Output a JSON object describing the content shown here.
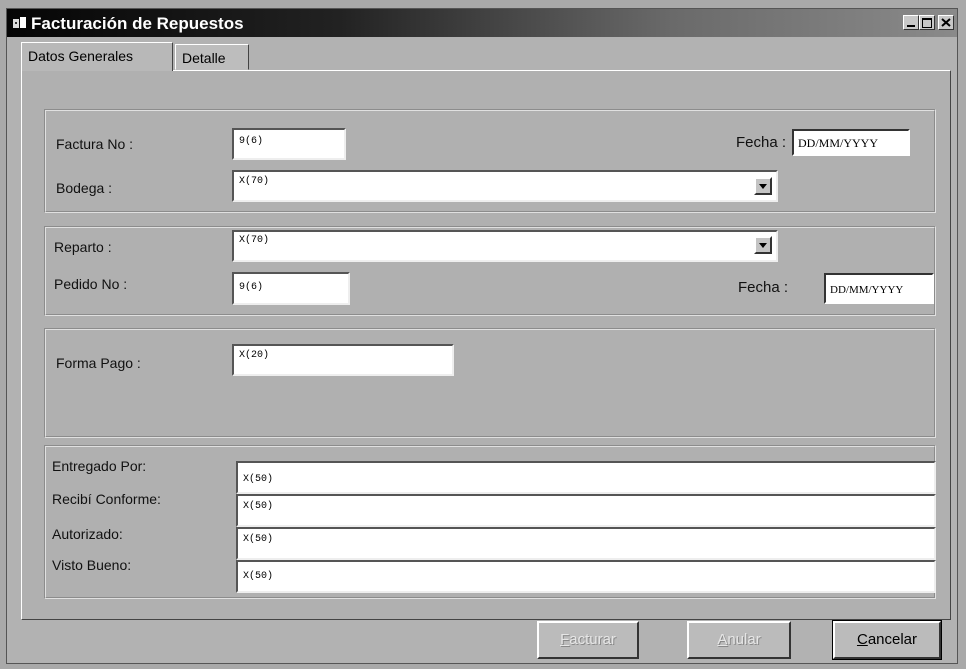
{
  "window": {
    "title": "Facturación de Repuestos"
  },
  "tabs": [
    {
      "label": "Datos Generales",
      "active": true
    },
    {
      "label": "Detalle",
      "active": false
    }
  ],
  "group1": {
    "factura_label": "Factura No :",
    "factura_value": "9(6)",
    "fecha_label": "Fecha :",
    "fecha_value": "DD/MM/YYYY",
    "bodega_label": "Bodega :",
    "bodega_value": "X(70)"
  },
  "group2": {
    "reparto_label": "Reparto :",
    "reparto_value": "X(70)",
    "pedido_label": "Pedido No :",
    "pedido_value": "9(6)",
    "fecha_label": "Fecha :",
    "fecha_value": "DD/MM/YYYY"
  },
  "group3": {
    "forma_pago_label": "Forma Pago :",
    "forma_pago_value": "X(20)"
  },
  "group4": {
    "entregado_label": "Entregado Por:",
    "entregado_value": "X(50)",
    "recibi_label": "Recibí Conforme:",
    "recibi_value": "X(50)",
    "autorizado_label": "Autorizado:",
    "autorizado_value": "X(50)",
    "visto_label": "Visto Bueno:",
    "visto_value": "X(50)"
  },
  "buttons": {
    "facturar_first": "F",
    "facturar_rest": "acturar",
    "anular_first": "A",
    "anular_rest": "nular",
    "cancelar_first": "C",
    "cancelar_rest": "ancelar"
  },
  "icons": [
    "app-icon",
    "minimize-icon",
    "maximize-icon",
    "close-icon",
    "dropdown-arrow-icon"
  ]
}
